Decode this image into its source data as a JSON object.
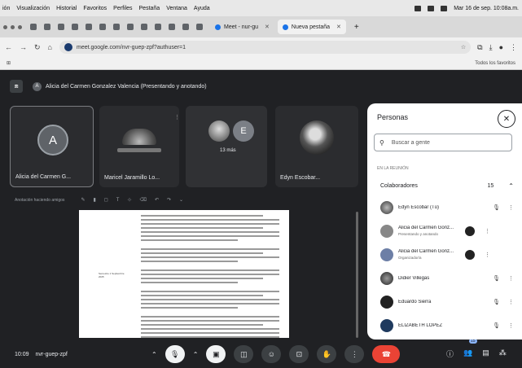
{
  "mac_menubar": {
    "items": [
      "ión",
      "Visualización",
      "Historial",
      "Favoritos",
      "Perfiles",
      "Pestaña",
      "Ventana",
      "Ayuda"
    ],
    "datetime": "Mar 16 de sep. 10:08a.m."
  },
  "browser": {
    "tabs": [
      {
        "label": "Meet - nur-gu",
        "active": false
      },
      {
        "label": "Nueva pestaña",
        "active": true
      }
    ],
    "url": "meet.google.com/nvr-guep-zpf?authuser=1",
    "bookmarks_all": "Todos los favoritos"
  },
  "meet": {
    "presenter": "Alicia del Carmen Gonzalez Valencia (Presentando y anotando)",
    "presenter_initial": "A",
    "tiles": [
      {
        "name": "Alicia del Carmen G...",
        "initial": "A"
      },
      {
        "name": "Maricel Jaramillo Lo...",
        "initial": ""
      },
      {
        "name": "13 más",
        "initial": "E"
      },
      {
        "name": "Edyn Escobar...",
        "initial": ""
      }
    ],
    "annotation_title": "Anotación haciendo amigos",
    "document": {
      "side_text": "Semestre 1 Septiembre 2025"
    },
    "bottom": {
      "time": "10:09",
      "meeting_code": "nvr-guep-zpf",
      "participants_badge": "15"
    }
  },
  "people_panel": {
    "title": "Personas",
    "search_placeholder": "Buscar a gente",
    "section_label": "EN LA REUNIÓN",
    "group_label": "Colaboradores",
    "group_count": "15",
    "participants": [
      {
        "name": "Edyn Escobar (Tú)",
        "sub": ""
      },
      {
        "name": "Alicia del Carmen Gonz...",
        "sub": "Presentando y anotando"
      },
      {
        "name": "Alicia del Carmen Gonz...",
        "sub": "Organizador/a"
      },
      {
        "name": "Didier Villegas",
        "sub": ""
      },
      {
        "name": "Eduardo Sierra",
        "sub": ""
      },
      {
        "name": "ELIZABETH LOPEZ",
        "sub": ""
      }
    ]
  }
}
